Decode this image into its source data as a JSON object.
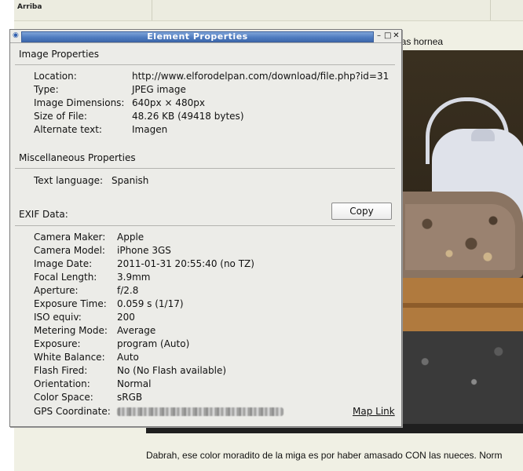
{
  "background": {
    "nav_link": "Arriba",
    "post_text_fragment": "has hornea",
    "bottom_text": "Dabrah, ese color moradito de la miga es por haber amasado CON las nueces. Norm"
  },
  "dialog": {
    "title": "Element Properties",
    "controls": {
      "minimize": "–",
      "maximize": "□",
      "close": "✕"
    },
    "image_properties": {
      "heading": "Image Properties",
      "rows": [
        {
          "label": "Location:",
          "value": "http://www.elforodelpan.com/download/file.php?id=31"
        },
        {
          "label": "Type:",
          "value": "JPEG image"
        },
        {
          "label": "Image Dimensions:",
          "value": "640px × 480px"
        },
        {
          "label": "Size of File:",
          "value": "48.26 KB (49418 bytes)"
        },
        {
          "label": "Alternate text:",
          "value": "Imagen"
        }
      ]
    },
    "misc_properties": {
      "heading": "Miscellaneous Properties",
      "rows": [
        {
          "label": "Text language:",
          "value": "Spanish"
        }
      ]
    },
    "exif": {
      "heading": "EXIF Data:",
      "copy_label": "Copy",
      "rows": [
        {
          "label": "Camera Maker:",
          "value": "Apple"
        },
        {
          "label": "Camera Model:",
          "value": "iPhone 3GS"
        },
        {
          "label": "Image Date:",
          "value": "2011-01-31 20:55:40 (no TZ)"
        },
        {
          "label": "Focal Length:",
          "value": "3.9mm"
        },
        {
          "label": "Aperture:",
          "value": "f/2.8"
        },
        {
          "label": "Exposure Time:",
          "value": "0.059 s (1/17)"
        },
        {
          "label": "ISO equiv:",
          "value": "200"
        },
        {
          "label": "Metering Mode:",
          "value": "Average"
        },
        {
          "label": "Exposure:",
          "value": "program (Auto)"
        },
        {
          "label": "White Balance:",
          "value": "Auto"
        },
        {
          "label": "Flash Fired:",
          "value": "No (No Flash available)"
        },
        {
          "label": "Orientation:",
          "value": "Normal"
        },
        {
          "label": "Color Space:",
          "value": "sRGB"
        },
        {
          "label": "GPS Coordinate:",
          "value": ""
        }
      ],
      "map_link": "Map Link"
    }
  }
}
